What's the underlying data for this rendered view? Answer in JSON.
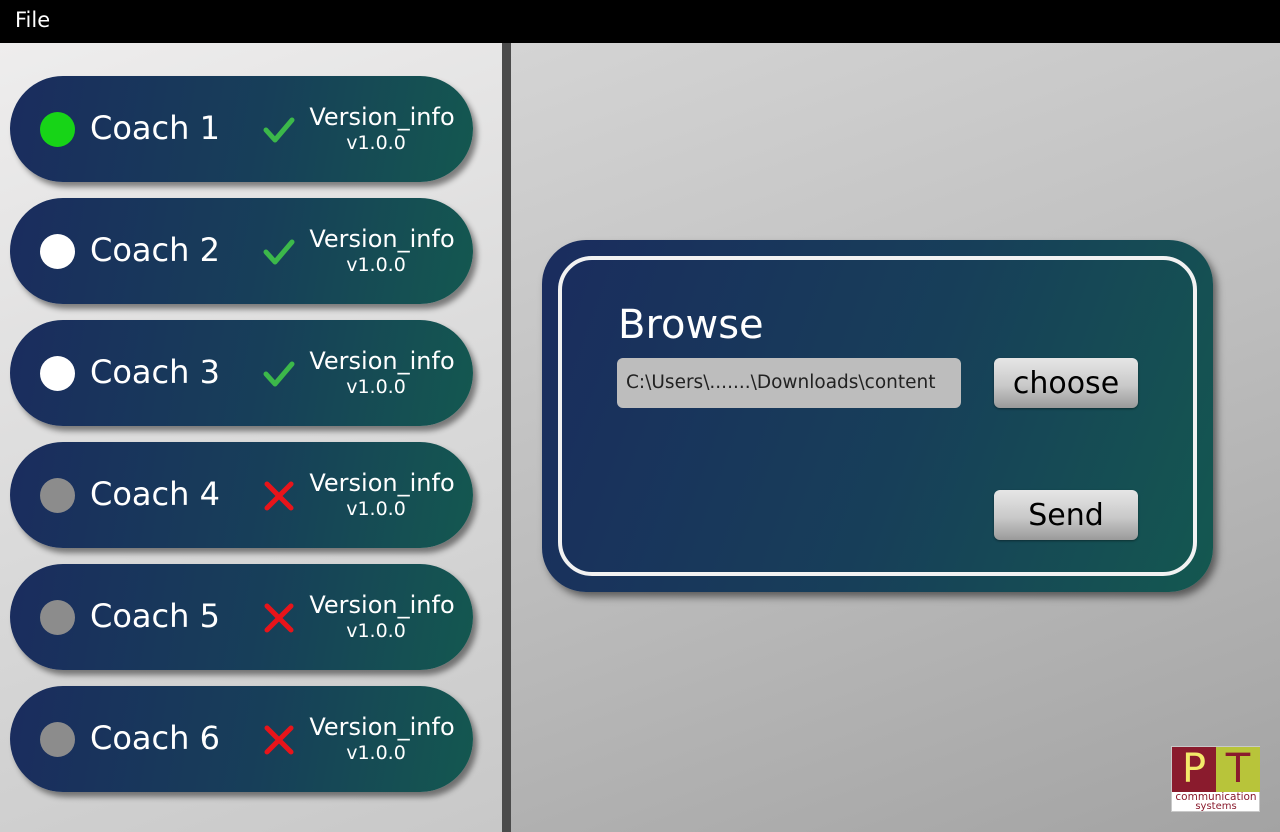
{
  "menubar": {
    "file_label": "File"
  },
  "coaches": [
    {
      "label": "Coach 1",
      "status": "connected",
      "dot_color": "#17d417",
      "mark": "check",
      "version_label": "Version_info",
      "version": "v1.0.0"
    },
    {
      "label": "Coach 2",
      "status": "available",
      "dot_color": "#ffffff",
      "mark": "check",
      "version_label": "Version_info",
      "version": "v1.0.0"
    },
    {
      "label": "Coach 3",
      "status": "available",
      "dot_color": "#ffffff",
      "mark": "check",
      "version_label": "Version_info",
      "version": "v1.0.0"
    },
    {
      "label": "Coach 4",
      "status": "offline",
      "dot_color": "#8c8c8c",
      "mark": "cross",
      "version_label": "Version_info",
      "version": "v1.0.0"
    },
    {
      "label": "Coach 5",
      "status": "offline",
      "dot_color": "#8c8c8c",
      "mark": "cross",
      "version_label": "Version_info",
      "version": "v1.0.0"
    },
    {
      "label": "Coach 6",
      "status": "offline",
      "dot_color": "#8c8c8c",
      "mark": "cross",
      "version_label": "Version_info",
      "version": "v1.0.0"
    }
  ],
  "browse": {
    "title": "Browse",
    "path_value": "C:\\Users\\.......\\Downloads\\content",
    "choose_label": "choose",
    "send_label": "Send"
  },
  "logo": {
    "letter1": "P",
    "letter2": "T",
    "line1": "communication",
    "line2": "systems"
  },
  "colors": {
    "card_gradient_start": "#1a2c5e",
    "card_gradient_end": "#145850",
    "check_color": "#3cb84a",
    "cross_color": "#e8141a"
  }
}
